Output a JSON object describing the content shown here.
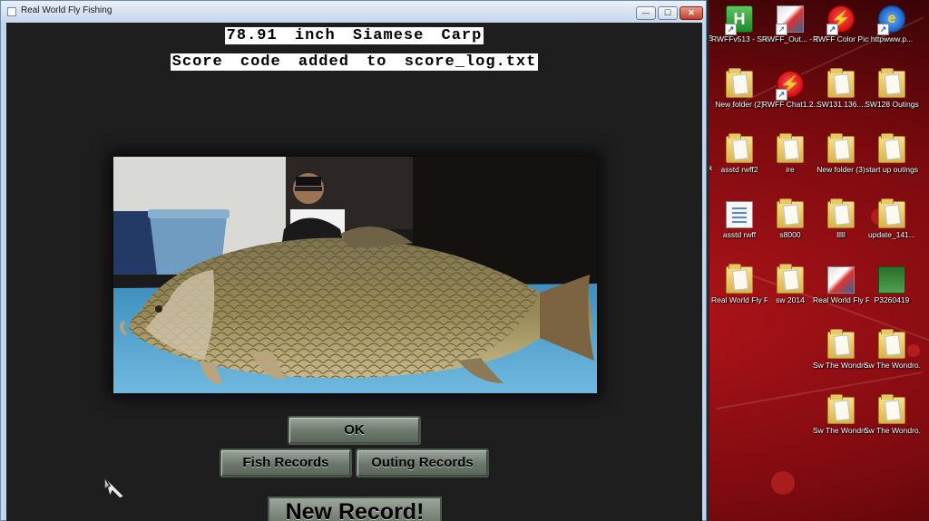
{
  "window": {
    "title": "Real World Fly Fishing",
    "controls": {
      "minimize": "—",
      "maximize": "☐",
      "close": "✕"
    }
  },
  "catch": {
    "line1": "78.91 inch Siamese Carp",
    "line2": "Score code added to score_log.txt"
  },
  "buttons": {
    "ok": "OK",
    "fish_records": "Fish Records",
    "outing_records": "Outing Records"
  },
  "banner": "New Record!",
  "desktop": {
    "edge_fragments": [
      "5",
      "k"
    ],
    "icons": [
      {
        "label": "RWFFv513 - Shortcut",
        "icon": "green-h-app-icon"
      },
      {
        "label": "RWFF_Out... - Shortcut",
        "icon": "fish-app-icon"
      },
      {
        "label": "RWFF Color Picker - S...",
        "icon": "flash-app-icon"
      },
      {
        "label": "httpwww.p...",
        "icon": "internet-shortcut-icon"
      },
      {
        "label": "New folder (2)",
        "icon": "folder-icon"
      },
      {
        "label": "RWFF Chat1.2...",
        "icon": "flash-app-icon"
      },
      {
        "label": "SW131.136....",
        "icon": "folder-icon"
      },
      {
        "label": "SW128 Outings",
        "icon": "folder-icon"
      },
      {
        "label": "asstd rwff2",
        "icon": "folder-icon"
      },
      {
        "label": "ire",
        "icon": "folder-icon"
      },
      {
        "label": "New folder (3)",
        "icon": "folder-icon"
      },
      {
        "label": "start up outings",
        "icon": "folder-icon"
      },
      {
        "label": "asstd rwff",
        "icon": "document-icon"
      },
      {
        "label": "s8000",
        "icon": "folder-icon"
      },
      {
        "label": "lllll",
        "icon": "folder-icon"
      },
      {
        "label": "update_141...",
        "icon": "folder-icon"
      },
      {
        "label": "Real World Fly Fishin...",
        "icon": "folder-icon"
      },
      {
        "label": "sw 2014",
        "icon": "folder-icon"
      },
      {
        "label": "Real World Fly Fishi...",
        "icon": "fish-app-icon"
      },
      {
        "label": "P3260419",
        "icon": "image-file-icon"
      },
      {
        "label": "Sw The Wondro...",
        "icon": "folder-icon"
      },
      {
        "label": "Sw The Wondro...",
        "icon": "folder-icon"
      },
      {
        "label": "Sw The Wondro...",
        "icon": "folder-icon"
      },
      {
        "label": "Sw The Wondro...",
        "icon": "folder-icon"
      }
    ]
  },
  "colors": {
    "client_bg": "#1e1e1e",
    "button_face": "#7b877b",
    "desktop_red": "#b0141a",
    "caption_bg": "#ffffff"
  }
}
